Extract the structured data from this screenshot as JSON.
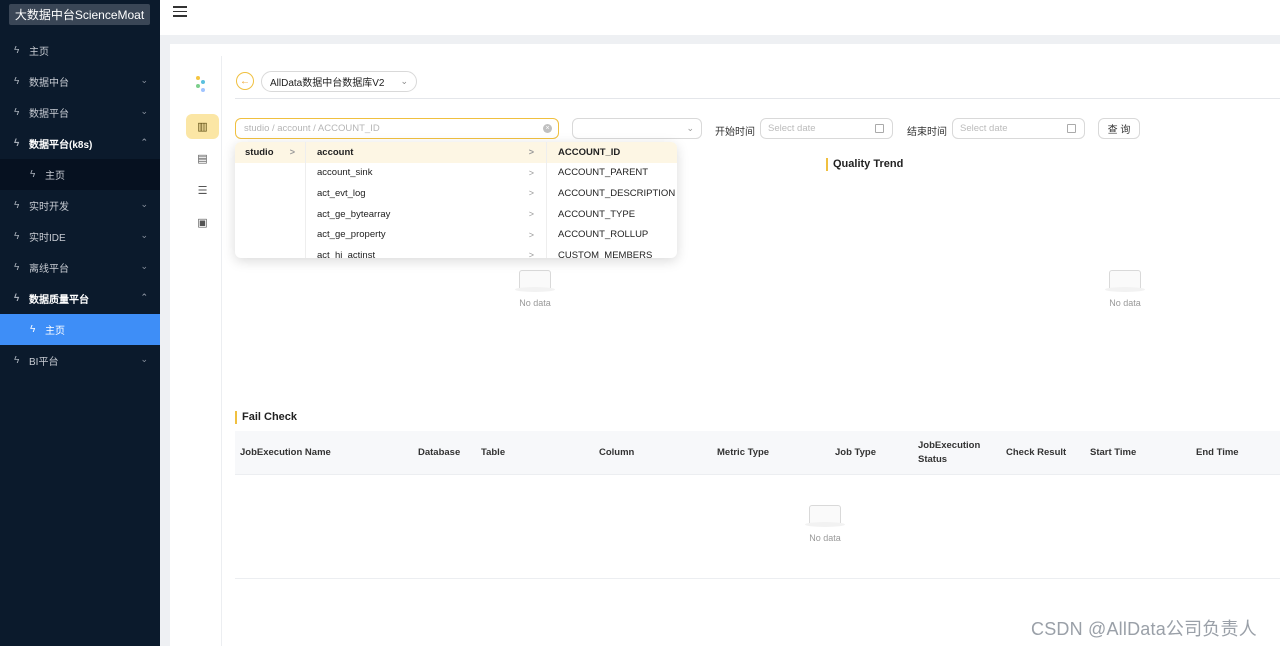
{
  "app": {
    "brand": "大数据中台ScienceMoat"
  },
  "sidebar": {
    "items": [
      {
        "label": "主页",
        "icon": "bolt-icon",
        "arrow": "",
        "kind": "top"
      },
      {
        "label": "数据中台",
        "icon": "bolt-icon",
        "arrow": "⌄",
        "kind": "top"
      },
      {
        "label": "数据平台",
        "icon": "bolt-icon",
        "arrow": "⌄",
        "kind": "top"
      },
      {
        "label": "数据平台(k8s)",
        "icon": "bolt-icon",
        "arrow": "⌃",
        "kind": "bold"
      },
      {
        "label": "主页",
        "icon": "bolt-icon",
        "arrow": "",
        "kind": "sub"
      },
      {
        "label": "实时开发",
        "icon": "bolt-icon",
        "arrow": "⌄",
        "kind": "top"
      },
      {
        "label": "实时IDE",
        "icon": "bolt-icon",
        "arrow": "⌄",
        "kind": "top"
      },
      {
        "label": "离线平台",
        "icon": "bolt-icon",
        "arrow": "⌄",
        "kind": "top"
      },
      {
        "label": "数据质量平台",
        "icon": "bolt-icon",
        "arrow": "⌃",
        "kind": "bold"
      },
      {
        "label": "主页",
        "icon": "bolt-icon",
        "arrow": "",
        "kind": "active"
      },
      {
        "label": "BI平台",
        "icon": "bolt-icon",
        "arrow": "⌄",
        "kind": "top"
      }
    ]
  },
  "toolbar": {
    "database_select": "AllData数据中台数据库V2",
    "cascader_placeholder": "studio / account / ACCOUNT_ID",
    "start_label": "开始时间",
    "end_label": "结束时间",
    "date_placeholder": "Select date",
    "query_label": "查 询"
  },
  "cascader_panel": {
    "col1": [
      "studio"
    ],
    "col2": [
      "account",
      "account_sink",
      "act_evt_log",
      "act_ge_bytearray",
      "act_ge_property",
      "act_hi_actinst"
    ],
    "col3": [
      "ACCOUNT_ID",
      "ACCOUNT_PARENT",
      "ACCOUNT_DESCRIPTION",
      "ACCOUNT_TYPE",
      "ACCOUNT_ROLLUP",
      "CUSTOM_MEMBERS"
    ]
  },
  "quality_trend": {
    "title": "Quality Trend"
  },
  "empty_text": "No data",
  "fail_check": {
    "title": "Fail Check",
    "columns": [
      "JobExecution Name",
      "Database",
      "Table",
      "Column",
      "Metric Type",
      "Job Type",
      "JobExecution Status",
      "Check Result",
      "Start Time",
      "End Time"
    ]
  },
  "watermark": "CSDN @AllData公司负责人",
  "colors": {
    "sidebar_bg": "#0b1a2c",
    "active": "#3e8ef7",
    "accent": "#f0c040"
  }
}
